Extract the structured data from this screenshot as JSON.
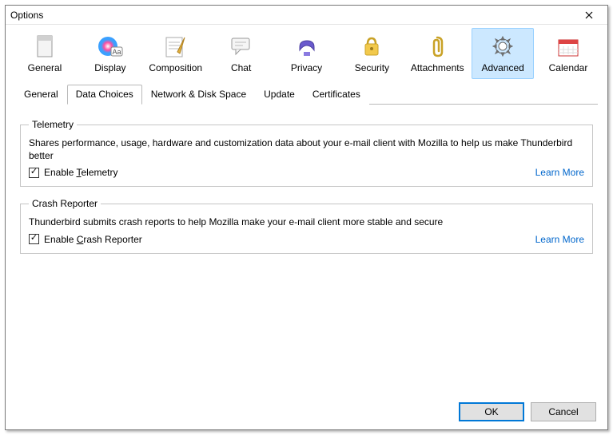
{
  "title": "Options",
  "toolbar": [
    {
      "id": "general",
      "label": "General"
    },
    {
      "id": "display",
      "label": "Display"
    },
    {
      "id": "composition",
      "label": "Composition"
    },
    {
      "id": "chat",
      "label": "Chat"
    },
    {
      "id": "privacy",
      "label": "Privacy"
    },
    {
      "id": "security",
      "label": "Security"
    },
    {
      "id": "attachments",
      "label": "Attachments"
    },
    {
      "id": "advanced",
      "label": "Advanced",
      "selected": true
    },
    {
      "id": "calendar",
      "label": "Calendar"
    }
  ],
  "subtabs": [
    {
      "id": "general",
      "label": "General"
    },
    {
      "id": "data-choices",
      "label": "Data Choices",
      "selected": true
    },
    {
      "id": "network",
      "label": "Network & Disk Space"
    },
    {
      "id": "update",
      "label": "Update"
    },
    {
      "id": "certificates",
      "label": "Certificates"
    }
  ],
  "telemetry": {
    "legend": "Telemetry",
    "desc": "Shares performance, usage, hardware and customization data about your e-mail client with Mozilla to help us make Thunderbird better",
    "checkbox_pre": "Enable ",
    "checkbox_mn": "T",
    "checkbox_post": "elemetry",
    "checked": true,
    "learn_more": "Learn More"
  },
  "crash": {
    "legend": "Crash Reporter",
    "desc": "Thunderbird submits crash reports to help Mozilla make your e-mail client more stable and secure",
    "checkbox_pre": "Enable ",
    "checkbox_mn": "C",
    "checkbox_post": "rash Reporter",
    "checked": true,
    "learn_more": "Learn More"
  },
  "buttons": {
    "ok": "OK",
    "cancel": "Cancel"
  }
}
